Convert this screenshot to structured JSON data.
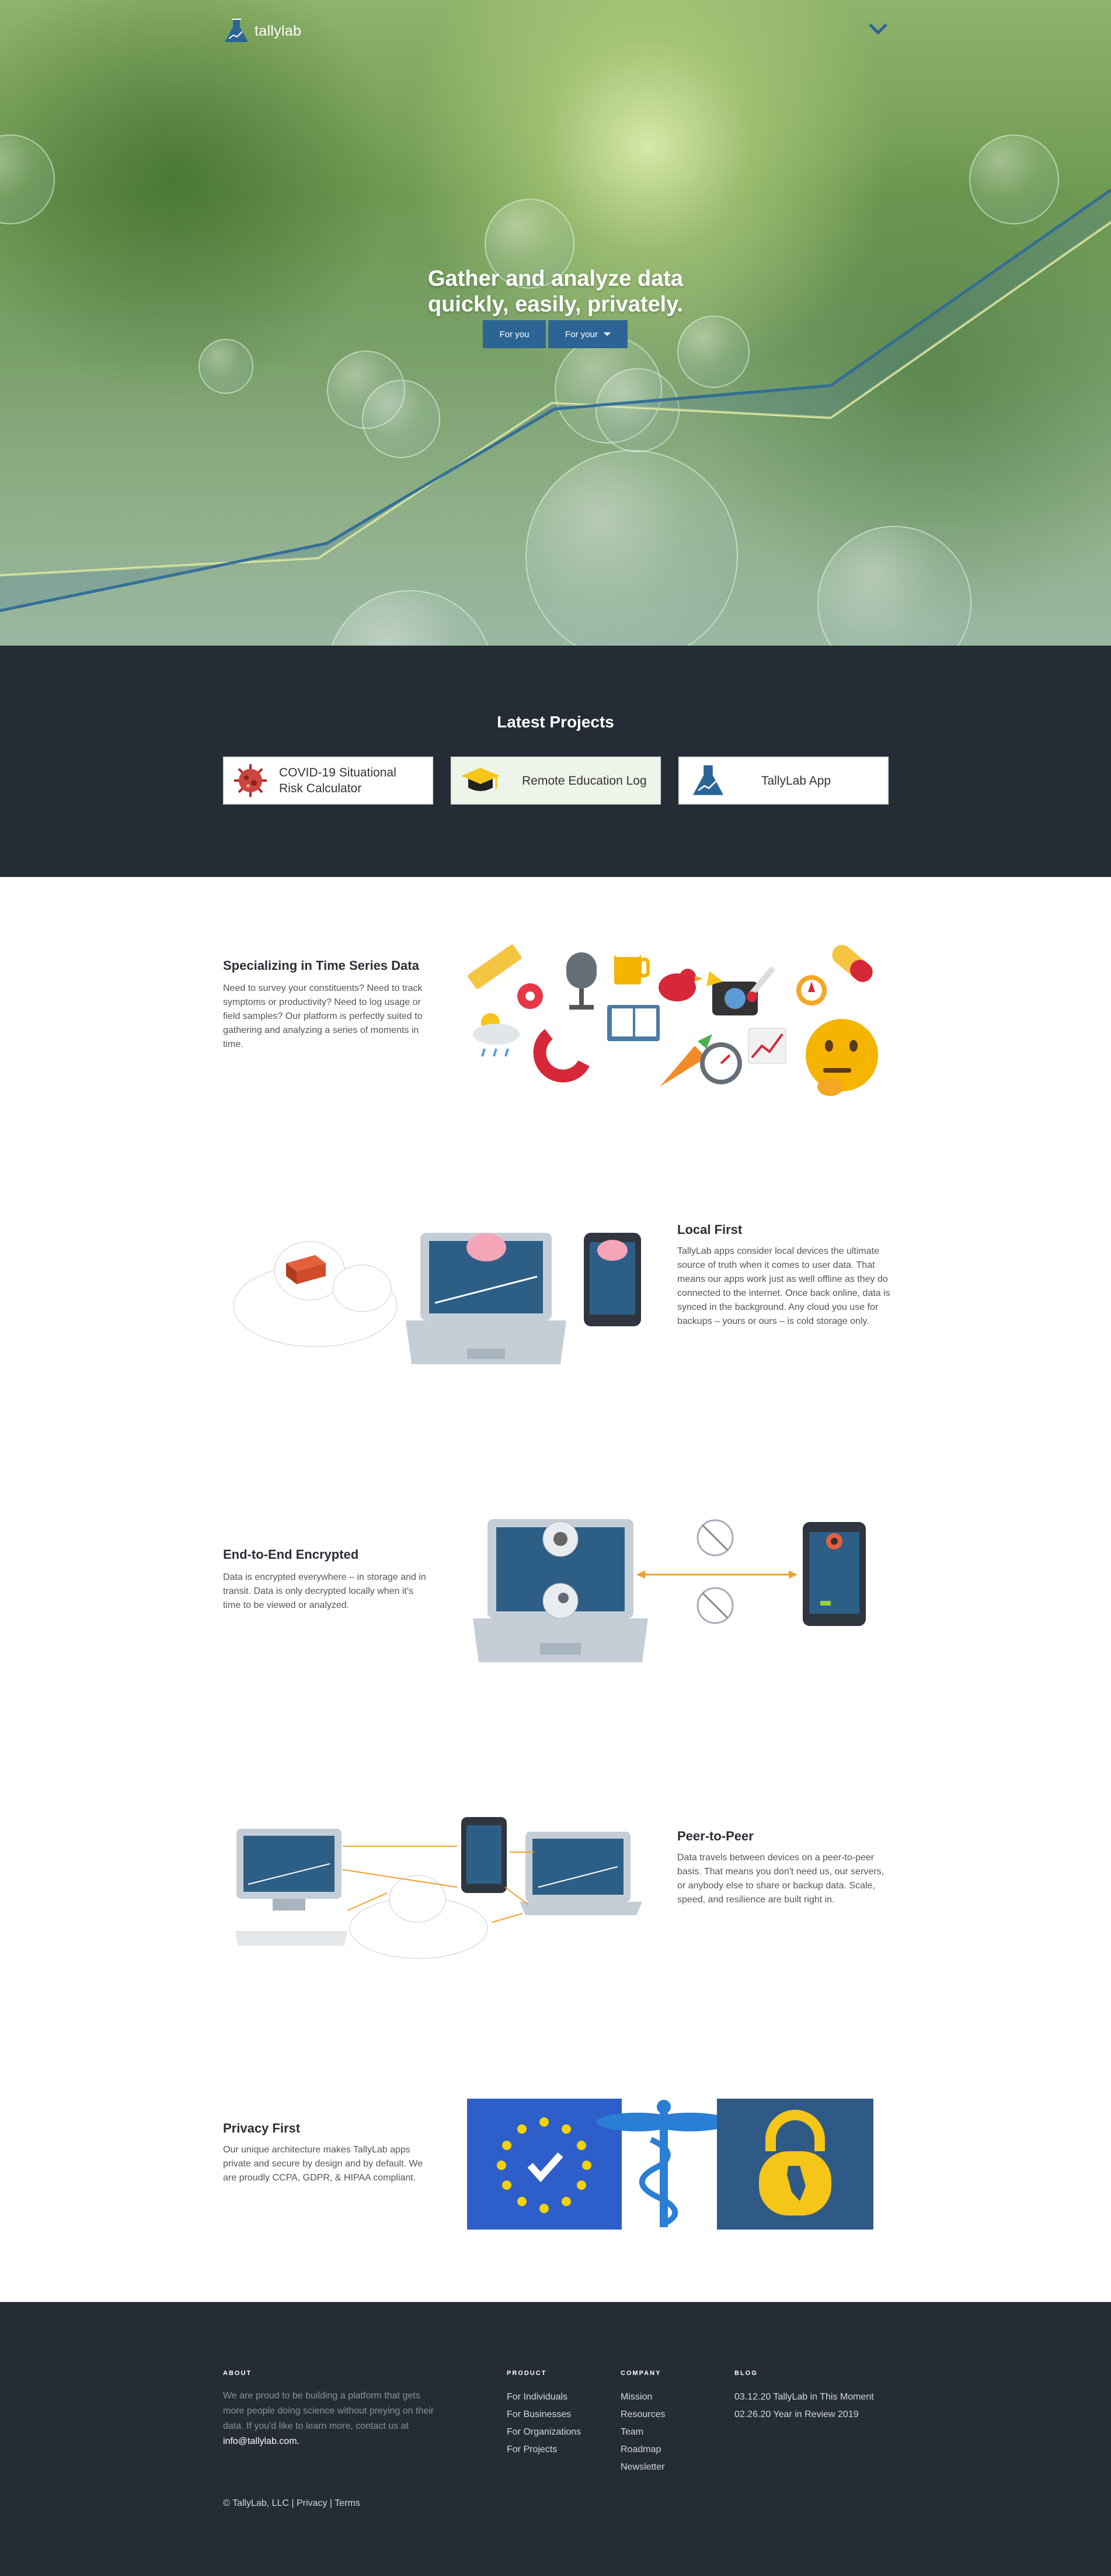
{
  "brand": {
    "name": "tallylab"
  },
  "hero": {
    "title_line1": "Gather and analyze data",
    "title_line2": "quickly, easily, privately.",
    "btn_for_you": "For you",
    "btn_for_your": "For your"
  },
  "projects": {
    "heading": "Latest Projects",
    "items": [
      {
        "line1": "COVID-19 Situational",
        "line2": "Risk Calculator",
        "icon": "virus-icon"
      },
      {
        "line1": "Remote Education Log",
        "line2": "",
        "icon": "graduation-cap-icon"
      },
      {
        "line1": "TallyLab App",
        "line2": "",
        "icon": "flask-icon"
      }
    ]
  },
  "features": [
    {
      "title": "Specializing in Time Series Data",
      "body": "Need to survey your constituents? Need to track symptoms or productivity? Need to log usage or field samples? Our platform is perfectly suited to gathering and analyzing a series of moments in time."
    },
    {
      "title": "Local First",
      "body": "TallyLab apps consider local devices the ultimate source of truth when it comes to user data. That means our apps work just as well offline as they do connected to the internet. Once back online, data is synced in the background. Any cloud you use for backups – yours or ours – is cold storage only."
    },
    {
      "title": "End-to-End Encrypted",
      "body": "Data is encrypted everywhere – in storage and in transit. Data is only decrypted locally when it's time to be viewed or analyzed."
    },
    {
      "title": "Peer-to-Peer",
      "body": "Data travels between devices on a peer-to-peer basis. That means you don't need us, our servers, or anybody else to share or backup data. Scale, speed, and resilience are built right in."
    },
    {
      "title": "Privacy First",
      "body": "Our unique architecture makes TallyLab apps private and secure by design and by default. We are proudly CCPA, GDPR, & HIPAA compliant."
    }
  ],
  "footer": {
    "about_heading": "ABOUT",
    "about_text": "We are proud to be building a platform that gets more people doing science without preying on their data. If you'd like to learn more, contact us at",
    "about_email": "info@tallylab.com.",
    "product_heading": "PRODUCT",
    "product_links": [
      "For Individuals",
      "For Businesses",
      "For Organizations",
      "For Projects"
    ],
    "company_heading": "COMPANY",
    "company_links": [
      "Mission",
      "Resources",
      "Team",
      "Roadmap",
      "Newsletter"
    ],
    "blog_heading": "BLOG",
    "blog_links": [
      "03.12.20 TallyLab in This Moment",
      "02.26.20 Year in Review 2019"
    ],
    "copyright": "© TallyLab, LLC |",
    "privacy": "Privacy",
    "sep": "|",
    "terms": "Terms"
  },
  "colors": {
    "accent": "#2c6595",
    "dark": "#262c36",
    "orange": "#f0a030"
  }
}
